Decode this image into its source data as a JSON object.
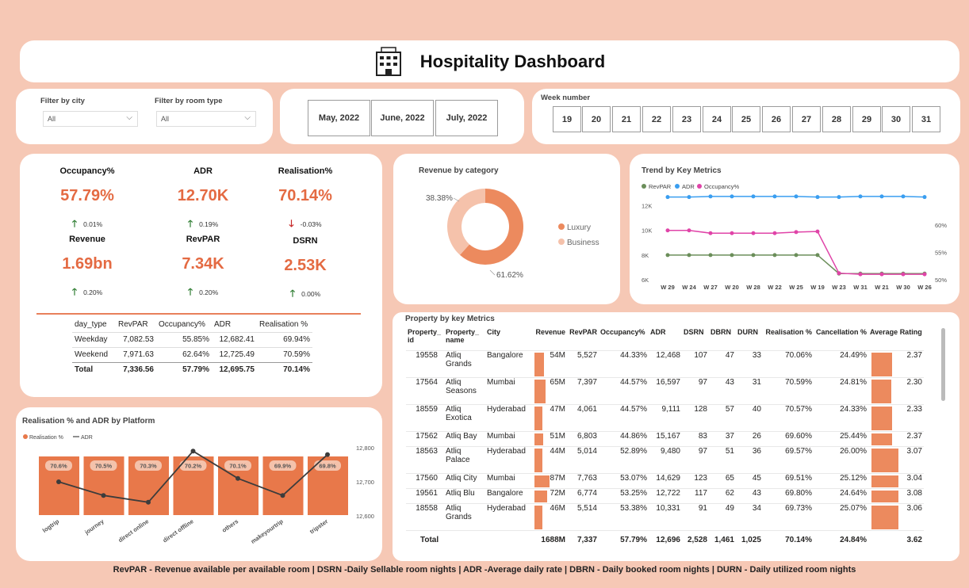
{
  "header": {
    "title": "Hospitality Dashboard",
    "icon": "hotel-icon"
  },
  "filters": {
    "city_label": "Filter by city",
    "city_value": "All",
    "room_label": "Filter by room type",
    "room_value": "All"
  },
  "months": [
    "May, 2022",
    "June, 2022",
    "July, 2022"
  ],
  "week": {
    "label": "Week number",
    "weeks": [
      "19",
      "20",
      "21",
      "22",
      "23",
      "24",
      "25",
      "26",
      "27",
      "28",
      "29",
      "30",
      "31"
    ]
  },
  "kpis": [
    {
      "title": "Occupancy%",
      "value": "57.79%",
      "delta": "0.01%",
      "dir": "up"
    },
    {
      "title": "ADR",
      "value": "12.70K",
      "delta": "0.19%",
      "dir": "up"
    },
    {
      "title": "Realisation%",
      "value": "70.14%",
      "delta": "-0.03%",
      "dir": "down"
    },
    {
      "title": "Revenue",
      "value": "1.69bn",
      "delta": "0.20%",
      "dir": "up"
    },
    {
      "title": "RevPAR",
      "value": "7.34K",
      "delta": "0.20%",
      "dir": "up"
    },
    {
      "title": "DSRN",
      "value": "2.53K",
      "delta": "0.00%",
      "dir": "up"
    }
  ],
  "daytype": {
    "headers": [
      "day_type",
      "RevPAR",
      "Occupancy%",
      "ADR",
      "Realisation %"
    ],
    "rows": [
      [
        "Weekday",
        "7,082.53",
        "55.85%",
        "12,682.41",
        "69.94%"
      ],
      [
        "Weekend",
        "7,971.63",
        "62.64%",
        "12,725.49",
        "70.59%"
      ]
    ],
    "total": [
      "Total",
      "7,336.56",
      "57.79%",
      "12,695.75",
      "70.14%"
    ]
  },
  "revenue_by_category": {
    "title": "Revenue by category",
    "labels": [
      "Luxury",
      "Business"
    ],
    "values": [
      61.62,
      38.38
    ],
    "label_texts": [
      "61.62%",
      "38.38%"
    ],
    "colors": [
      "#ec8a5e",
      "#f5c2ab"
    ]
  },
  "trend": {
    "title": "Trend by Key Metrics",
    "legend": [
      "RevPAR",
      "ADR",
      "Occupancy%"
    ],
    "colors": [
      "#6b8e5a",
      "#3a9ef0",
      "#e044a8"
    ]
  },
  "platform": {
    "title": "Realisation % and ADR by Platform",
    "legend": [
      "Realisation %",
      "ADR"
    ]
  },
  "property": {
    "title": "Property by key Metrics",
    "headers": [
      "Property_ id",
      "Property_ name",
      "City",
      "Revenue",
      "RevPAR",
      "Occupancy%",
      "ADR",
      "DSRN",
      "DBRN",
      "DURN",
      "Realisation %",
      "Cancellation %",
      "Average Rating"
    ],
    "rows": [
      {
        "id": "19558",
        "name": "Atliq Grands",
        "city": "Bangalore",
        "rev": "54M",
        "revpar": "5,527",
        "occ": "44.33%",
        "adr": "12,468",
        "dsrn": "107",
        "dbrn": "47",
        "durn": "33",
        "real": "70.06%",
        "canc": "24.49%",
        "rating": "2.37"
      },
      {
        "id": "17564",
        "name": "Atliq Seasons",
        "city": "Mumbai",
        "rev": "65M",
        "revpar": "7,397",
        "occ": "44.57%",
        "adr": "16,597",
        "dsrn": "97",
        "dbrn": "43",
        "durn": "31",
        "real": "70.59%",
        "canc": "24.81%",
        "rating": "2.30"
      },
      {
        "id": "18559",
        "name": "Atliq Exotica",
        "city": "Hyderabad",
        "rev": "47M",
        "revpar": "4,061",
        "occ": "44.57%",
        "adr": "9,111",
        "dsrn": "128",
        "dbrn": "57",
        "durn": "40",
        "real": "70.57%",
        "canc": "24.33%",
        "rating": "2.33"
      },
      {
        "id": "17562",
        "name": "Atliq Bay",
        "city": "Mumbai",
        "rev": "51M",
        "revpar": "6,803",
        "occ": "44.86%",
        "adr": "15,167",
        "dsrn": "83",
        "dbrn": "37",
        "durn": "26",
        "real": "69.60%",
        "canc": "25.44%",
        "rating": "2.37"
      },
      {
        "id": "18563",
        "name": "Atliq Palace",
        "city": "Hyderabad",
        "rev": "44M",
        "revpar": "5,014",
        "occ": "52.89%",
        "adr": "9,480",
        "dsrn": "97",
        "dbrn": "51",
        "durn": "36",
        "real": "69.57%",
        "canc": "26.00%",
        "rating": "3.07"
      },
      {
        "id": "17560",
        "name": "Atliq City",
        "city": "Mumbai",
        "rev": "87M",
        "revpar": "7,763",
        "occ": "53.07%",
        "adr": "14,629",
        "dsrn": "123",
        "dbrn": "65",
        "durn": "45",
        "real": "69.51%",
        "canc": "25.12%",
        "rating": "3.04"
      },
      {
        "id": "19561",
        "name": "Atliq Blu",
        "city": "Bangalore",
        "rev": "72M",
        "revpar": "6,774",
        "occ": "53.25%",
        "adr": "12,722",
        "dsrn": "117",
        "dbrn": "62",
        "durn": "43",
        "real": "69.80%",
        "canc": "24.64%",
        "rating": "3.08"
      },
      {
        "id": "18558",
        "name": "Atliq Grands",
        "city": "Hyderabad",
        "rev": "46M",
        "revpar": "5,514",
        "occ": "53.38%",
        "adr": "10,331",
        "dsrn": "91",
        "dbrn": "49",
        "durn": "34",
        "real": "69.73%",
        "canc": "25.07%",
        "rating": "3.06"
      }
    ],
    "total": {
      "label": "Total",
      "rev": "1688M",
      "revpar": "7,337",
      "occ": "57.79%",
      "adr": "12,696",
      "dsrn": "2,528",
      "dbrn": "1,461",
      "durn": "1,025",
      "real": "70.14%",
      "canc": "24.84%",
      "rating": "3.62"
    }
  },
  "footer": "RevPAR - Revenue available per available room | DSRN -Daily Sellable room nights |  ADR -Average daily rate | DBRN - Daily booked room nights | DURN - Daily utilized room nights",
  "chart_data": [
    {
      "type": "pie",
      "title": "Revenue by category",
      "categories": [
        "Luxury",
        "Business"
      ],
      "values": [
        61.62,
        38.38
      ]
    },
    {
      "type": "line",
      "title": "Trend by Key Metrics",
      "categories": [
        "W 29",
        "W 24",
        "W 27",
        "W 20",
        "W 28",
        "W 22",
        "W 25",
        "W 19",
        "W 23",
        "W 31",
        "W 21",
        "W 30",
        "W 26"
      ],
      "series": [
        {
          "name": "RevPAR",
          "axis": "left",
          "values": [
            8000,
            8000,
            8000,
            8000,
            8000,
            8000,
            8000,
            8000,
            6500,
            6500,
            6500,
            6500,
            6500
          ]
        },
        {
          "name": "ADR",
          "axis": "left",
          "values": [
            12700,
            12700,
            12750,
            12750,
            12750,
            12750,
            12750,
            12700,
            12700,
            12750,
            12750,
            12750,
            12700
          ]
        },
        {
          "name": "Occupancy%",
          "axis": "right",
          "values": [
            59,
            59,
            58.5,
            58.5,
            58.5,
            58.5,
            58.7,
            58.8,
            51.2,
            51,
            51,
            51,
            51
          ]
        }
      ],
      "yticks_left": [
        "6K",
        "8K",
        "10K",
        "12K"
      ],
      "yticks_right": [
        "50%",
        "55%",
        "60%"
      ],
      "ylim_left": [
        6000,
        13000
      ],
      "ylim_right": [
        50,
        62
      ]
    },
    {
      "type": "bar",
      "title": "Realisation % and ADR by Platform",
      "categories": [
        "logtrip",
        "journey",
        "direct online",
        "direct offline",
        "others",
        "makeyourtrip",
        "tripster"
      ],
      "series": [
        {
          "name": "Realisation %",
          "values": [
            70.6,
            70.5,
            70.3,
            70.2,
            70.1,
            69.9,
            69.8
          ],
          "labels": [
            "70.6%",
            "70.5%",
            "70.3%",
            "70.2%",
            "70.1%",
            "69.9%",
            "69.8%"
          ]
        },
        {
          "name": "ADR",
          "axis": "right",
          "values": [
            12700,
            12660,
            12640,
            12790,
            12710,
            12660,
            12780
          ]
        }
      ],
      "yticks_right": [
        "12,600",
        "12,700",
        "12,800"
      ],
      "ylim_right": [
        12600,
        12800
      ]
    }
  ]
}
